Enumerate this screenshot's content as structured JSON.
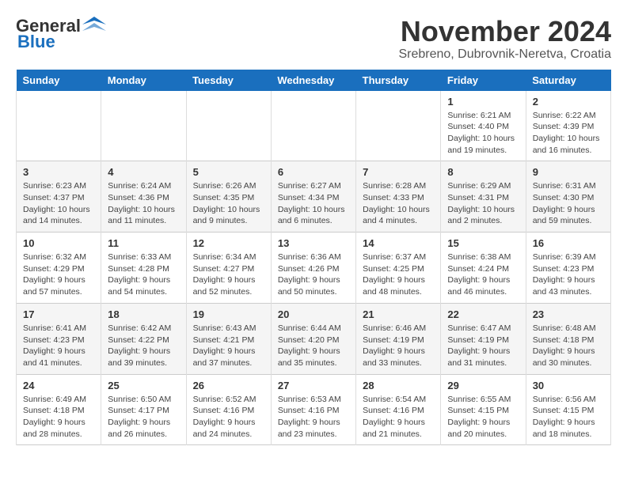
{
  "header": {
    "logo_general": "General",
    "logo_blue": "Blue",
    "month_title": "November 2024",
    "location": "Srebreno, Dubrovnik-Neretva, Croatia"
  },
  "weekdays": [
    "Sunday",
    "Monday",
    "Tuesday",
    "Wednesday",
    "Thursday",
    "Friday",
    "Saturday"
  ],
  "weeks": [
    [
      {
        "day": "",
        "info": ""
      },
      {
        "day": "",
        "info": ""
      },
      {
        "day": "",
        "info": ""
      },
      {
        "day": "",
        "info": ""
      },
      {
        "day": "",
        "info": ""
      },
      {
        "day": "1",
        "info": "Sunrise: 6:21 AM\nSunset: 4:40 PM\nDaylight: 10 hours and 19 minutes."
      },
      {
        "day": "2",
        "info": "Sunrise: 6:22 AM\nSunset: 4:39 PM\nDaylight: 10 hours and 16 minutes."
      }
    ],
    [
      {
        "day": "3",
        "info": "Sunrise: 6:23 AM\nSunset: 4:37 PM\nDaylight: 10 hours and 14 minutes."
      },
      {
        "day": "4",
        "info": "Sunrise: 6:24 AM\nSunset: 4:36 PM\nDaylight: 10 hours and 11 minutes."
      },
      {
        "day": "5",
        "info": "Sunrise: 6:26 AM\nSunset: 4:35 PM\nDaylight: 10 hours and 9 minutes."
      },
      {
        "day": "6",
        "info": "Sunrise: 6:27 AM\nSunset: 4:34 PM\nDaylight: 10 hours and 6 minutes."
      },
      {
        "day": "7",
        "info": "Sunrise: 6:28 AM\nSunset: 4:33 PM\nDaylight: 10 hours and 4 minutes."
      },
      {
        "day": "8",
        "info": "Sunrise: 6:29 AM\nSunset: 4:31 PM\nDaylight: 10 hours and 2 minutes."
      },
      {
        "day": "9",
        "info": "Sunrise: 6:31 AM\nSunset: 4:30 PM\nDaylight: 9 hours and 59 minutes."
      }
    ],
    [
      {
        "day": "10",
        "info": "Sunrise: 6:32 AM\nSunset: 4:29 PM\nDaylight: 9 hours and 57 minutes."
      },
      {
        "day": "11",
        "info": "Sunrise: 6:33 AM\nSunset: 4:28 PM\nDaylight: 9 hours and 54 minutes."
      },
      {
        "day": "12",
        "info": "Sunrise: 6:34 AM\nSunset: 4:27 PM\nDaylight: 9 hours and 52 minutes."
      },
      {
        "day": "13",
        "info": "Sunrise: 6:36 AM\nSunset: 4:26 PM\nDaylight: 9 hours and 50 minutes."
      },
      {
        "day": "14",
        "info": "Sunrise: 6:37 AM\nSunset: 4:25 PM\nDaylight: 9 hours and 48 minutes."
      },
      {
        "day": "15",
        "info": "Sunrise: 6:38 AM\nSunset: 4:24 PM\nDaylight: 9 hours and 46 minutes."
      },
      {
        "day": "16",
        "info": "Sunrise: 6:39 AM\nSunset: 4:23 PM\nDaylight: 9 hours and 43 minutes."
      }
    ],
    [
      {
        "day": "17",
        "info": "Sunrise: 6:41 AM\nSunset: 4:23 PM\nDaylight: 9 hours and 41 minutes."
      },
      {
        "day": "18",
        "info": "Sunrise: 6:42 AM\nSunset: 4:22 PM\nDaylight: 9 hours and 39 minutes."
      },
      {
        "day": "19",
        "info": "Sunrise: 6:43 AM\nSunset: 4:21 PM\nDaylight: 9 hours and 37 minutes."
      },
      {
        "day": "20",
        "info": "Sunrise: 6:44 AM\nSunset: 4:20 PM\nDaylight: 9 hours and 35 minutes."
      },
      {
        "day": "21",
        "info": "Sunrise: 6:46 AM\nSunset: 4:19 PM\nDaylight: 9 hours and 33 minutes."
      },
      {
        "day": "22",
        "info": "Sunrise: 6:47 AM\nSunset: 4:19 PM\nDaylight: 9 hours and 31 minutes."
      },
      {
        "day": "23",
        "info": "Sunrise: 6:48 AM\nSunset: 4:18 PM\nDaylight: 9 hours and 30 minutes."
      }
    ],
    [
      {
        "day": "24",
        "info": "Sunrise: 6:49 AM\nSunset: 4:18 PM\nDaylight: 9 hours and 28 minutes."
      },
      {
        "day": "25",
        "info": "Sunrise: 6:50 AM\nSunset: 4:17 PM\nDaylight: 9 hours and 26 minutes."
      },
      {
        "day": "26",
        "info": "Sunrise: 6:52 AM\nSunset: 4:16 PM\nDaylight: 9 hours and 24 minutes."
      },
      {
        "day": "27",
        "info": "Sunrise: 6:53 AM\nSunset: 4:16 PM\nDaylight: 9 hours and 23 minutes."
      },
      {
        "day": "28",
        "info": "Sunrise: 6:54 AM\nSunset: 4:16 PM\nDaylight: 9 hours and 21 minutes."
      },
      {
        "day": "29",
        "info": "Sunrise: 6:55 AM\nSunset: 4:15 PM\nDaylight: 9 hours and 20 minutes."
      },
      {
        "day": "30",
        "info": "Sunrise: 6:56 AM\nSunset: 4:15 PM\nDaylight: 9 hours and 18 minutes."
      }
    ]
  ]
}
